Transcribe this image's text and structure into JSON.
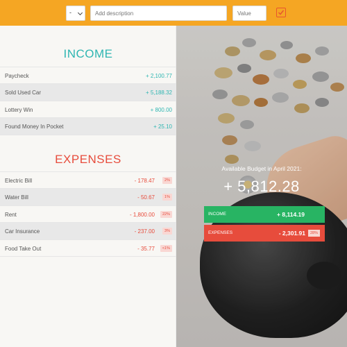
{
  "toolbar": {
    "type_select_value": "-",
    "description_placeholder": "Add description",
    "value_placeholder": "Value"
  },
  "income": {
    "title": "INCOME",
    "items": [
      {
        "label": "Paycheck",
        "amount": "+ 2,100.77"
      },
      {
        "label": "Sold Used Car",
        "amount": "+ 5,188.32"
      },
      {
        "label": "Lottery Win",
        "amount": "+ 800.00"
      },
      {
        "label": "Found Money In Pocket",
        "amount": "+ 25.10"
      }
    ]
  },
  "expenses": {
    "title": "EXPENSES",
    "items": [
      {
        "label": "Electric Bill",
        "amount": "- 178.47",
        "percent": "2%"
      },
      {
        "label": "Water Bill",
        "amount": "- 50.67",
        "percent": "1%"
      },
      {
        "label": "Rent",
        "amount": "- 1,800.00",
        "percent": "22%"
      },
      {
        "label": "Car Insurance",
        "amount": "- 237.00",
        "percent": "3%"
      },
      {
        "label": "Food Take Out",
        "amount": "- 35.77",
        "percent": "<1%"
      }
    ]
  },
  "summary": {
    "label": "Available Budget in April 2021:",
    "value": "+ 5,812.28",
    "income_label": "INCOME",
    "income_value": "+ 8,114.19",
    "expense_label": "EXPENSES",
    "expense_value": "- 2,301.91",
    "expense_percent": "28%"
  },
  "colors": {
    "topbar": "#f5a623",
    "income_accent": "#2fb6b2",
    "expense_accent": "#e74c3c",
    "income_bar": "#28b463",
    "expense_bar": "#e74c3c"
  },
  "icons": {
    "add": "checkbox-check-icon",
    "select": "chevron-down-icon"
  }
}
